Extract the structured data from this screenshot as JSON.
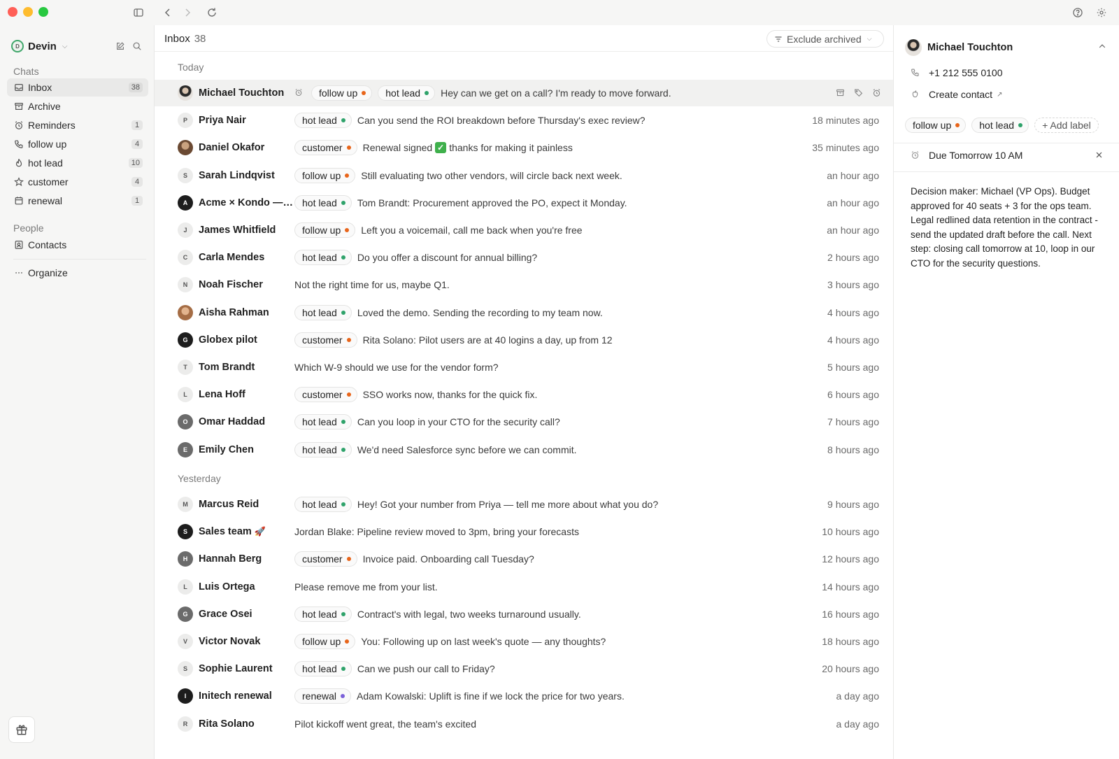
{
  "sidebar": {
    "user": {
      "name": "Devin",
      "initial": "D"
    },
    "chats_heading": "Chats",
    "people_heading": "People",
    "items": [
      {
        "label": "Inbox",
        "count": "38"
      },
      {
        "label": "Archive",
        "count": ""
      },
      {
        "label": "Reminders",
        "count": "1"
      },
      {
        "label": "follow up",
        "count": "4"
      },
      {
        "label": "hot lead",
        "count": "10"
      },
      {
        "label": "customer",
        "count": "4"
      },
      {
        "label": "renewal",
        "count": "1"
      }
    ],
    "contacts_label": "Contacts",
    "organize_label": "Organize"
  },
  "main": {
    "title": "Inbox",
    "count": "38",
    "filter_label": "Exclude archived",
    "groups": {
      "today": "Today",
      "yesterday": "Yesterday"
    },
    "rows": [
      {
        "name": "Michael Touchton",
        "initial": "",
        "labels": [
          {
            "text": "follow up",
            "color": "orange"
          },
          {
            "text": "hot lead",
            "color": "green"
          }
        ],
        "message": "Hey can we get on a call? I'm ready to move forward.",
        "time": ""
      },
      {
        "name": "Priya Nair",
        "initial": "P",
        "labels": [
          {
            "text": "hot lead",
            "color": "green"
          }
        ],
        "message": "Can you send the ROI breakdown before Thursday's exec review?",
        "time": "18 minutes ago"
      },
      {
        "name": "Daniel Okafor",
        "initial": "",
        "labels": [
          {
            "text": "customer",
            "color": "orange"
          }
        ],
        "message_pre": "Renewal signed",
        "message_post": "thanks for making it painless",
        "time": "35 minutes ago"
      },
      {
        "name": "Sarah Lindqvist",
        "initial": "S",
        "labels": [
          {
            "text": "follow up",
            "color": "orange"
          }
        ],
        "message": "Still evaluating two other vendors, will circle back next week.",
        "time": "an hour ago"
      },
      {
        "name": "Acme × Kondo — d...",
        "initial": "A",
        "labels": [
          {
            "text": "hot lead",
            "color": "green"
          }
        ],
        "message": "Tom Brandt: Procurement approved the PO, expect it Monday.",
        "time": "an hour ago"
      },
      {
        "name": "James Whitfield",
        "initial": "J",
        "labels": [
          {
            "text": "follow up",
            "color": "orange"
          }
        ],
        "message": "Left you a voicemail, call me back when you're free",
        "time": "an hour ago"
      },
      {
        "name": "Carla Mendes",
        "initial": "C",
        "labels": [
          {
            "text": "hot lead",
            "color": "green"
          }
        ],
        "message": "Do you offer a discount for annual billing?",
        "time": "2 hours ago"
      },
      {
        "name": "Noah Fischer",
        "initial": "N",
        "labels": [],
        "message": "Not the right time for us, maybe Q1.",
        "time": "3 hours ago"
      },
      {
        "name": "Aisha Rahman",
        "initial": "",
        "labels": [
          {
            "text": "hot lead",
            "color": "green"
          }
        ],
        "message": "Loved the demo. Sending the recording to my team now.",
        "time": "4 hours ago"
      },
      {
        "name": "Globex pilot",
        "initial": "G",
        "labels": [
          {
            "text": "customer",
            "color": "orange"
          }
        ],
        "message": "Rita Solano: Pilot users are at 40 logins a day, up from 12",
        "time": "4 hours ago"
      },
      {
        "name": "Tom Brandt",
        "initial": "T",
        "labels": [],
        "message": "Which W-9 should we use for the vendor form?",
        "time": "5 hours ago"
      },
      {
        "name": "Lena Hoff",
        "initial": "L",
        "labels": [
          {
            "text": "customer",
            "color": "orange"
          }
        ],
        "message": "SSO works now, thanks for the quick fix.",
        "time": "6 hours ago"
      },
      {
        "name": "Omar Haddad",
        "initial": "O",
        "labels": [
          {
            "text": "hot lead",
            "color": "green"
          }
        ],
        "message": "Can you loop in your CTO for the security call?",
        "time": "7 hours ago"
      },
      {
        "name": "Emily Chen",
        "initial": "E",
        "labels": [
          {
            "text": "hot lead",
            "color": "green"
          }
        ],
        "message": "We'd need Salesforce sync before we can commit.",
        "time": "8 hours ago"
      },
      {
        "name": "Marcus Reid",
        "initial": "M",
        "labels": [
          {
            "text": "hot lead",
            "color": "green"
          }
        ],
        "message": "Hey! Got your number from Priya — tell me more about what you do?",
        "time": "9 hours ago"
      },
      {
        "name": "Sales team",
        "initial": "S",
        "labels": [],
        "message": "Jordan Blake: Pipeline review moved to 3pm, bring your forecasts",
        "time": "10 hours ago"
      },
      {
        "name": "Hannah Berg",
        "initial": "H",
        "labels": [
          {
            "text": "customer",
            "color": "orange"
          }
        ],
        "message": "Invoice paid. Onboarding call Tuesday?",
        "time": "12 hours ago"
      },
      {
        "name": "Luis Ortega",
        "initial": "L",
        "labels": [],
        "message": "Please remove me from your list.",
        "time": "14 hours ago"
      },
      {
        "name": "Grace Osei",
        "initial": "G",
        "labels": [
          {
            "text": "hot lead",
            "color": "green"
          }
        ],
        "message": "Contract's with legal, two weeks turnaround usually.",
        "time": "16 hours ago"
      },
      {
        "name": "Victor Novak",
        "initial": "V",
        "labels": [
          {
            "text": "follow up",
            "color": "orange"
          }
        ],
        "message": "You: Following up on last week's quote — any thoughts?",
        "time": "18 hours ago"
      },
      {
        "name": "Sophie Laurent",
        "initial": "S",
        "labels": [
          {
            "text": "hot lead",
            "color": "green"
          }
        ],
        "message": "Can we push our call to Friday?",
        "time": "20 hours ago"
      },
      {
        "name": "Initech renewal",
        "initial": "I",
        "labels": [
          {
            "text": "renewal",
            "color": "purple"
          }
        ],
        "message": "Adam Kowalski: Uplift is fine if we lock the price for two years.",
        "time": "a day ago"
      },
      {
        "name": "Rita Solano",
        "initial": "R",
        "labels": [],
        "message": "Pilot kickoff went great, the team's excited",
        "time": "a day ago"
      }
    ]
  },
  "panel": {
    "contact_name": "Michael Touchton",
    "phone": "+1 212 555 0100",
    "create_contact": "Create contact",
    "labels": [
      {
        "text": "follow up",
        "color": "orange"
      },
      {
        "text": "hot lead",
        "color": "green"
      }
    ],
    "add_label": "+ Add label",
    "due": "Due Tomorrow 10 AM",
    "notes": "Decision maker: Michael (VP Ops). Budget approved for 40 seats + 3 for the ops team. Legal redlined data retention in the contract - send the updated draft before the call. Next step: closing call tomorrow at 10, loop in our CTO for the security questions."
  },
  "colors": {
    "orange_dot": "#e8651a",
    "green_dot": "#2ea26a",
    "purple_dot": "#7b61d9",
    "traffic_red": "#ff5f57",
    "traffic_yellow": "#febc2e",
    "traffic_green": "#28c840"
  }
}
